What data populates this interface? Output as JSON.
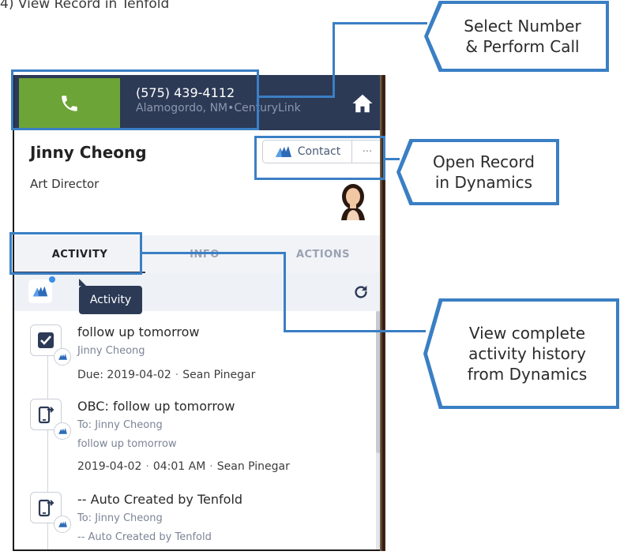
{
  "step_title": "4) View Record in Tenfold",
  "call_bar": {
    "phone_number": "(575) 439-4112",
    "location": "Alamogordo, NM•CenturyLink"
  },
  "contact": {
    "name": "Jinny Cheong",
    "title": "Art Director",
    "contact_button_label": "Contact",
    "more_button_label": "···"
  },
  "tabs": [
    {
      "label": "ACTIVITY",
      "active": true
    },
    {
      "label": "INFO",
      "active": false
    },
    {
      "label": "ACTIONS",
      "active": false
    }
  ],
  "subbar": {
    "tooltip": "Activity"
  },
  "activities": [
    {
      "icon": "checkbox-task-icon",
      "title": "follow up tomorrow",
      "line1": "Jinny Cheong",
      "meta": {
        "due": "Due: 2019-04-02",
        "owner": "Sean Pinegar"
      }
    },
    {
      "icon": "phone-call-icon",
      "title": "OBC: follow up tomorrow",
      "line1": "To: Jinny Cheong",
      "line2": "follow up tomorrow",
      "meta": {
        "date": "2019-04-02",
        "time": "04:01 AM",
        "owner": "Sean Pinegar"
      }
    },
    {
      "icon": "phone-call-icon",
      "title": "-- Auto Created by Tenfold",
      "line1": "To: Jinny Cheong",
      "line2": "-- Auto Created by Tenfold"
    }
  ],
  "callouts": {
    "select_number": "Select Number\n& Perform Call",
    "open_record": "Open Record\nin Dynamics",
    "view_history": "View complete\nactivity history\nfrom Dynamics"
  },
  "colors": {
    "accent": "#3a7fc4",
    "call_green": "#6da437",
    "navy": "#2c3a56"
  }
}
